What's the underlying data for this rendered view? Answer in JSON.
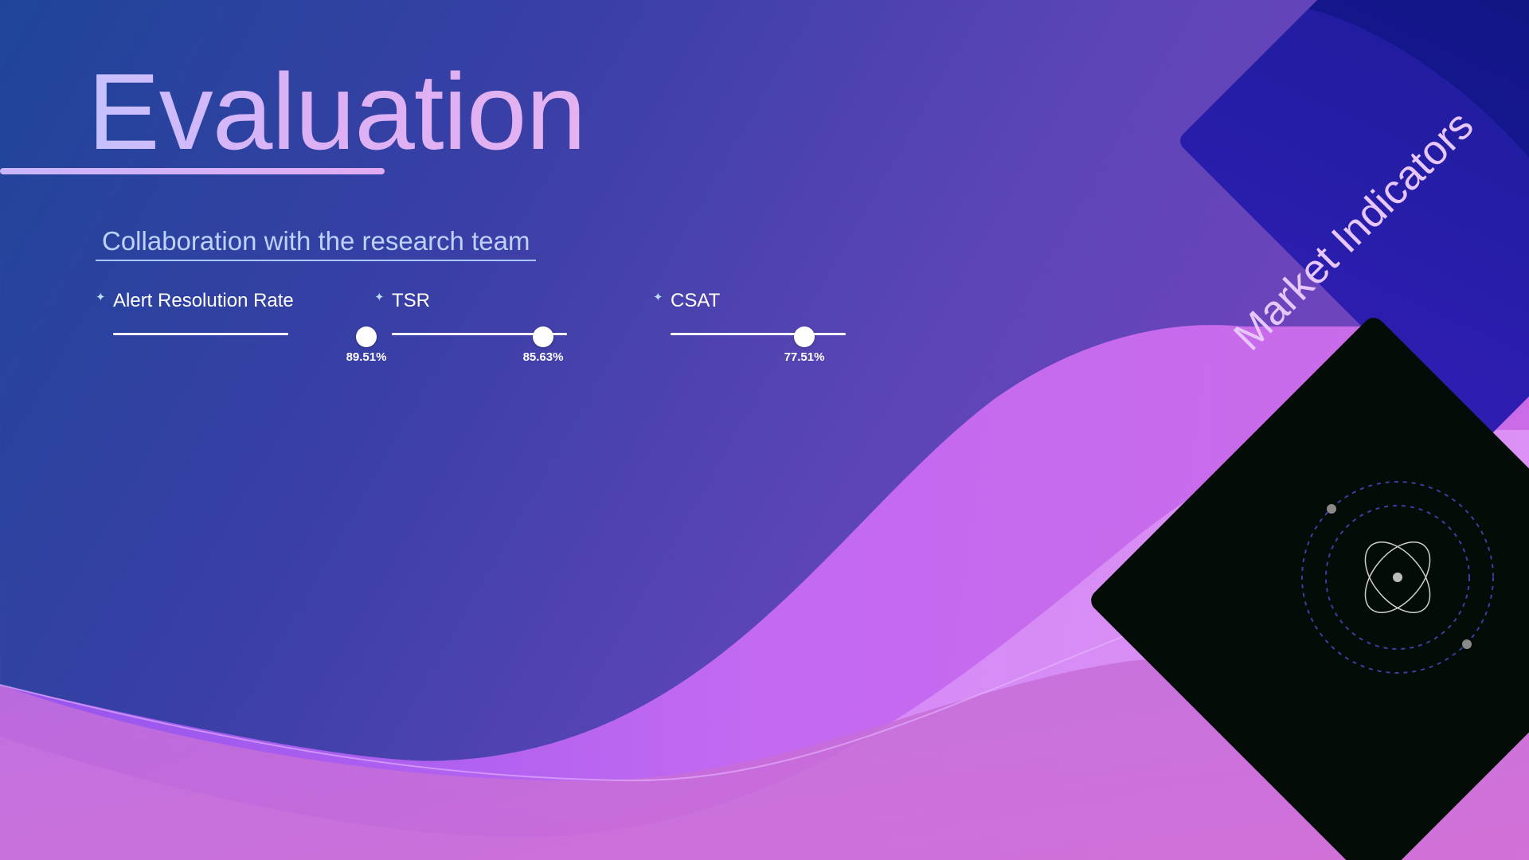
{
  "slide": {
    "title": "Evaluation",
    "subtitle": "Collaboration with the research team"
  },
  "metrics": [
    {
      "label": "Alert Resolution Rate",
      "value_text": "89.51%",
      "value": 0.8951,
      "icon": "sparkle-icon"
    },
    {
      "label": "TSR",
      "value_text": "85.63%",
      "value": 0.8563,
      "icon": "sparkle-icon"
    },
    {
      "label": "CSAT",
      "value_text": "77.51%",
      "value": 0.7751,
      "icon": "sparkle-icon"
    }
  ],
  "side_card": {
    "title": "Market Indicators",
    "icon": "orbit-atom-icon"
  },
  "colors": {
    "background_start": "#1f4599",
    "background_end": "#7d46c4",
    "wave_light": "#c86ef5",
    "title": "#d9b3ff",
    "subtitle": "#bcd2ff",
    "card_blue": "#161891",
    "card_black": "#040c08",
    "slider": "#ffffff"
  }
}
